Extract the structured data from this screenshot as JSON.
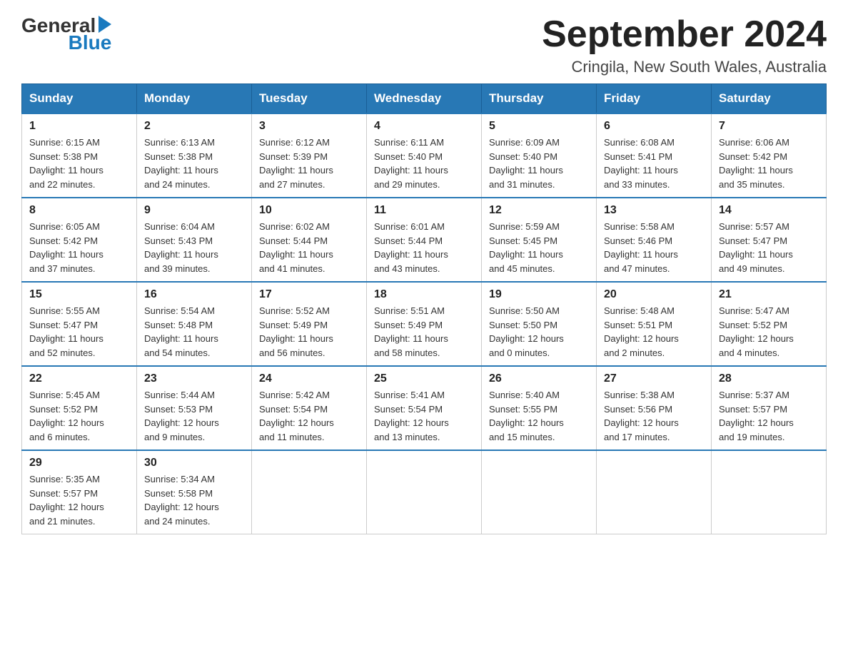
{
  "header": {
    "logo_general": "General",
    "logo_blue": "Blue",
    "title": "September 2024",
    "subtitle": "Cringila, New South Wales, Australia"
  },
  "days_of_week": [
    "Sunday",
    "Monday",
    "Tuesday",
    "Wednesday",
    "Thursday",
    "Friday",
    "Saturday"
  ],
  "weeks": [
    [
      {
        "day": "1",
        "sunrise": "6:15 AM",
        "sunset": "5:38 PM",
        "daylight": "11 hours and 22 minutes."
      },
      {
        "day": "2",
        "sunrise": "6:13 AM",
        "sunset": "5:38 PM",
        "daylight": "11 hours and 24 minutes."
      },
      {
        "day": "3",
        "sunrise": "6:12 AM",
        "sunset": "5:39 PM",
        "daylight": "11 hours and 27 minutes."
      },
      {
        "day": "4",
        "sunrise": "6:11 AM",
        "sunset": "5:40 PM",
        "daylight": "11 hours and 29 minutes."
      },
      {
        "day": "5",
        "sunrise": "6:09 AM",
        "sunset": "5:40 PM",
        "daylight": "11 hours and 31 minutes."
      },
      {
        "day": "6",
        "sunrise": "6:08 AM",
        "sunset": "5:41 PM",
        "daylight": "11 hours and 33 minutes."
      },
      {
        "day": "7",
        "sunrise": "6:06 AM",
        "sunset": "5:42 PM",
        "daylight": "11 hours and 35 minutes."
      }
    ],
    [
      {
        "day": "8",
        "sunrise": "6:05 AM",
        "sunset": "5:42 PM",
        "daylight": "11 hours and 37 minutes."
      },
      {
        "day": "9",
        "sunrise": "6:04 AM",
        "sunset": "5:43 PM",
        "daylight": "11 hours and 39 minutes."
      },
      {
        "day": "10",
        "sunrise": "6:02 AM",
        "sunset": "5:44 PM",
        "daylight": "11 hours and 41 minutes."
      },
      {
        "day": "11",
        "sunrise": "6:01 AM",
        "sunset": "5:44 PM",
        "daylight": "11 hours and 43 minutes."
      },
      {
        "day": "12",
        "sunrise": "5:59 AM",
        "sunset": "5:45 PM",
        "daylight": "11 hours and 45 minutes."
      },
      {
        "day": "13",
        "sunrise": "5:58 AM",
        "sunset": "5:46 PM",
        "daylight": "11 hours and 47 minutes."
      },
      {
        "day": "14",
        "sunrise": "5:57 AM",
        "sunset": "5:47 PM",
        "daylight": "11 hours and 49 minutes."
      }
    ],
    [
      {
        "day": "15",
        "sunrise": "5:55 AM",
        "sunset": "5:47 PM",
        "daylight": "11 hours and 52 minutes."
      },
      {
        "day": "16",
        "sunrise": "5:54 AM",
        "sunset": "5:48 PM",
        "daylight": "11 hours and 54 minutes."
      },
      {
        "day": "17",
        "sunrise": "5:52 AM",
        "sunset": "5:49 PM",
        "daylight": "11 hours and 56 minutes."
      },
      {
        "day": "18",
        "sunrise": "5:51 AM",
        "sunset": "5:49 PM",
        "daylight": "11 hours and 58 minutes."
      },
      {
        "day": "19",
        "sunrise": "5:50 AM",
        "sunset": "5:50 PM",
        "daylight": "12 hours and 0 minutes."
      },
      {
        "day": "20",
        "sunrise": "5:48 AM",
        "sunset": "5:51 PM",
        "daylight": "12 hours and 2 minutes."
      },
      {
        "day": "21",
        "sunrise": "5:47 AM",
        "sunset": "5:52 PM",
        "daylight": "12 hours and 4 minutes."
      }
    ],
    [
      {
        "day": "22",
        "sunrise": "5:45 AM",
        "sunset": "5:52 PM",
        "daylight": "12 hours and 6 minutes."
      },
      {
        "day": "23",
        "sunrise": "5:44 AM",
        "sunset": "5:53 PM",
        "daylight": "12 hours and 9 minutes."
      },
      {
        "day": "24",
        "sunrise": "5:42 AM",
        "sunset": "5:54 PM",
        "daylight": "12 hours and 11 minutes."
      },
      {
        "day": "25",
        "sunrise": "5:41 AM",
        "sunset": "5:54 PM",
        "daylight": "12 hours and 13 minutes."
      },
      {
        "day": "26",
        "sunrise": "5:40 AM",
        "sunset": "5:55 PM",
        "daylight": "12 hours and 15 minutes."
      },
      {
        "day": "27",
        "sunrise": "5:38 AM",
        "sunset": "5:56 PM",
        "daylight": "12 hours and 17 minutes."
      },
      {
        "day": "28",
        "sunrise": "5:37 AM",
        "sunset": "5:57 PM",
        "daylight": "12 hours and 19 minutes."
      }
    ],
    [
      {
        "day": "29",
        "sunrise": "5:35 AM",
        "sunset": "5:57 PM",
        "daylight": "12 hours and 21 minutes."
      },
      {
        "day": "30",
        "sunrise": "5:34 AM",
        "sunset": "5:58 PM",
        "daylight": "12 hours and 24 minutes."
      },
      null,
      null,
      null,
      null,
      null
    ]
  ],
  "labels": {
    "sunrise": "Sunrise:",
    "sunset": "Sunset:",
    "daylight": "Daylight:"
  }
}
